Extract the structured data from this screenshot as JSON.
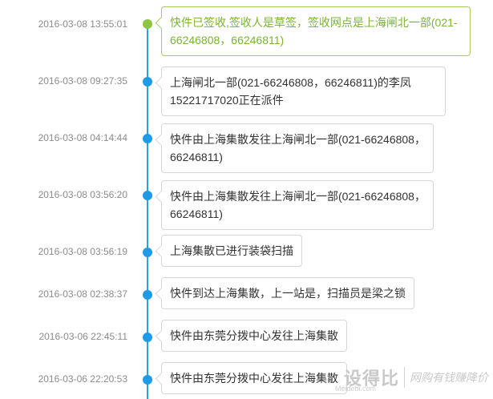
{
  "tracking": {
    "events": [
      {
        "time": "2016-03-08 13:55:01",
        "text_lines": [
          "快件已签收,签收人是草签，签收网点是上海闸北一部(021-",
          "66246808，66246811)"
        ],
        "status": "latest"
      },
      {
        "time": "2016-03-08 09:27:35",
        "text_lines": [
          "上海闸北一部(021-66246808，66246811)的李凤",
          "15221717020正在派件"
        ],
        "status": "normal"
      },
      {
        "time": "2016-03-08 04:14:44",
        "text_lines": [
          "快件由上海集散发往上海闸北一部(021-66246808，",
          "66246811)"
        ],
        "status": "normal"
      },
      {
        "time": "2016-03-08 03:56:20",
        "text_lines": [
          "快件由上海集散发往上海闸北一部(021-66246808，",
          "66246811)"
        ],
        "status": "normal"
      },
      {
        "time": "2016-03-08 03:56:19",
        "text_lines": [
          "上海集散已进行装袋扫描"
        ],
        "status": "normal"
      },
      {
        "time": "2016-03-08 02:38:37",
        "text_lines": [
          "快件到达上海集散，上一站是，扫描员是梁之锁"
        ],
        "status": "normal"
      },
      {
        "time": "2016-03-06 22:45:11",
        "text_lines": [
          "快件由东莞分拨中心发往上海集散"
        ],
        "status": "normal"
      },
      {
        "time": "2016-03-06 22:20:53",
        "text_lines": [
          "快件由东莞分拨中心发往上海集散"
        ],
        "status": "normal"
      }
    ]
  },
  "watermark": {
    "brand": "设得比",
    "slogan": "网购有钱赚降价",
    "site": "Meidebi.com"
  },
  "colors": {
    "timeline_line": "#2aa3e6",
    "dot_normal": "#1e9be6",
    "dot_latest": "#8cc63f",
    "latest_text": "#7ab432",
    "latest_border": "#a6cc5a"
  }
}
